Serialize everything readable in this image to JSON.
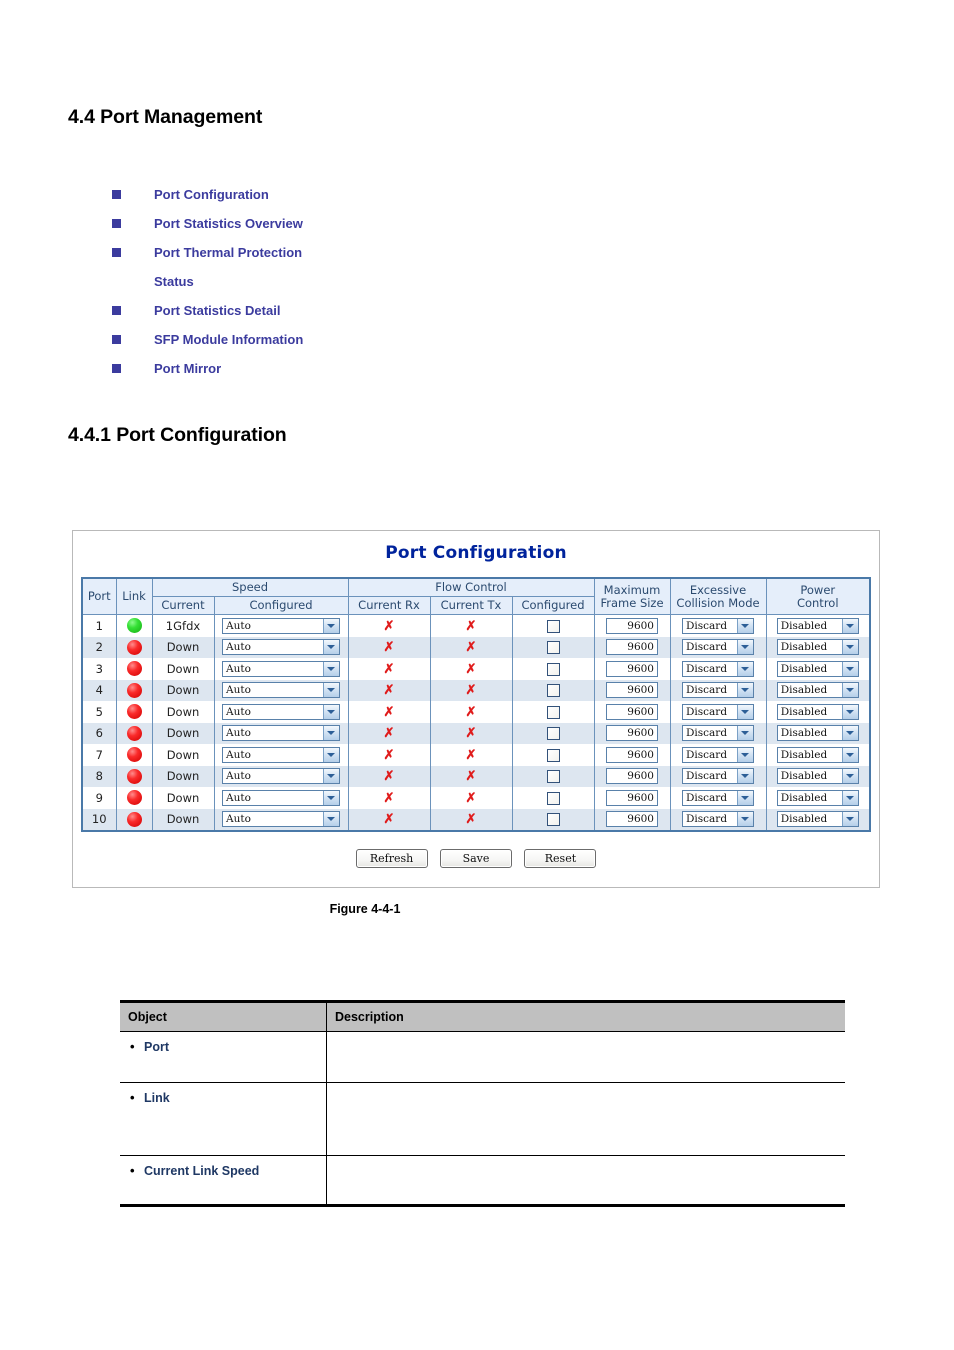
{
  "document": {
    "section_heading": "4.4 Port Management",
    "subsection_heading": "4.4.1 Port Configuration",
    "figure_caption": "Figure 4-4-1"
  },
  "toc_list": [
    {
      "label": "Port Configuration",
      "bullet": true
    },
    {
      "label": "Port Statistics Overview",
      "bullet": true
    },
    {
      "label": "Port Thermal Protection",
      "bullet": true
    },
    {
      "label": "Status",
      "bullet": false
    },
    {
      "label": "Port Statistics Detail",
      "bullet": true
    },
    {
      "label": "SFP Module Information",
      "bullet": true
    },
    {
      "label": "Port Mirror",
      "bullet": true
    }
  ],
  "screenshot": {
    "title": "Port Configuration",
    "headers": {
      "port": "Port",
      "link": "Link",
      "speed": "Speed",
      "speed_current": "Current",
      "speed_configured": "Configured",
      "flow_control": "Flow Control",
      "fc_current_rx": "Current Rx",
      "fc_current_tx": "Current Tx",
      "fc_configured": "Configured",
      "maximum_frame_size": "Maximum Frame Size",
      "excessive_collision_mode": "Excessive Collision Mode",
      "power_control": "Power Control"
    },
    "rows": [
      {
        "port": "1",
        "link_state": "up",
        "current_speed": "1Gfdx",
        "configured_speed": "Auto",
        "current_rx": "✗",
        "current_tx": "✗",
        "fc_configured_checked": false,
        "max_frame_size": "9600",
        "excessive_collision_mode": "Discard",
        "power_control": "Disabled"
      },
      {
        "port": "2",
        "link_state": "down",
        "current_speed": "Down",
        "configured_speed": "Auto",
        "current_rx": "✗",
        "current_tx": "✗",
        "fc_configured_checked": false,
        "max_frame_size": "9600",
        "excessive_collision_mode": "Discard",
        "power_control": "Disabled"
      },
      {
        "port": "3",
        "link_state": "down",
        "current_speed": "Down",
        "configured_speed": "Auto",
        "current_rx": "✗",
        "current_tx": "✗",
        "fc_configured_checked": false,
        "max_frame_size": "9600",
        "excessive_collision_mode": "Discard",
        "power_control": "Disabled"
      },
      {
        "port": "4",
        "link_state": "down",
        "current_speed": "Down",
        "configured_speed": "Auto",
        "current_rx": "✗",
        "current_tx": "✗",
        "fc_configured_checked": false,
        "max_frame_size": "9600",
        "excessive_collision_mode": "Discard",
        "power_control": "Disabled"
      },
      {
        "port": "5",
        "link_state": "down",
        "current_speed": "Down",
        "configured_speed": "Auto",
        "current_rx": "✗",
        "current_tx": "✗",
        "fc_configured_checked": false,
        "max_frame_size": "9600",
        "excessive_collision_mode": "Discard",
        "power_control": "Disabled"
      },
      {
        "port": "6",
        "link_state": "down",
        "current_speed": "Down",
        "configured_speed": "Auto",
        "current_rx": "✗",
        "current_tx": "✗",
        "fc_configured_checked": false,
        "max_frame_size": "9600",
        "excessive_collision_mode": "Discard",
        "power_control": "Disabled"
      },
      {
        "port": "7",
        "link_state": "down",
        "current_speed": "Down",
        "configured_speed": "Auto",
        "current_rx": "✗",
        "current_tx": "✗",
        "fc_configured_checked": false,
        "max_frame_size": "9600",
        "excessive_collision_mode": "Discard",
        "power_control": "Disabled"
      },
      {
        "port": "8",
        "link_state": "down",
        "current_speed": "Down",
        "configured_speed": "Auto",
        "current_rx": "✗",
        "current_tx": "✗",
        "fc_configured_checked": false,
        "max_frame_size": "9600",
        "excessive_collision_mode": "Discard",
        "power_control": "Disabled"
      },
      {
        "port": "9",
        "link_state": "down",
        "current_speed": "Down",
        "configured_speed": "Auto",
        "current_rx": "✗",
        "current_tx": "✗",
        "fc_configured_checked": false,
        "max_frame_size": "9600",
        "excessive_collision_mode": "Discard",
        "power_control": "Disabled"
      },
      {
        "port": "10",
        "link_state": "down",
        "current_speed": "Down",
        "configured_speed": "Auto",
        "current_rx": "✗",
        "current_tx": "✗",
        "fc_configured_checked": false,
        "max_frame_size": "9600",
        "excessive_collision_mode": "Discard",
        "power_control": "Disabled"
      }
    ],
    "buttons": {
      "refresh": "Refresh",
      "save": "Save",
      "reset": "Reset"
    }
  },
  "object_table": {
    "headers": {
      "object": "Object",
      "description": "Description"
    },
    "rows": [
      {
        "object": "Port",
        "description": ""
      },
      {
        "object": "Link",
        "description": ""
      },
      {
        "object": "Current Link Speed",
        "description": ""
      }
    ]
  },
  "colors": {
    "link_text": "#3b3b9e",
    "panel_title": "#00239c",
    "table_header_bg": "#e5eefa",
    "table_header_text": "#2b4a6f",
    "row_stripe": "#dde6f0",
    "led_up": "#13ad13",
    "led_down": "#cf0000",
    "x_mark": "#e01b1b",
    "object_header_bg": "#c0c0c0",
    "object_label_text": "#1f3864"
  }
}
